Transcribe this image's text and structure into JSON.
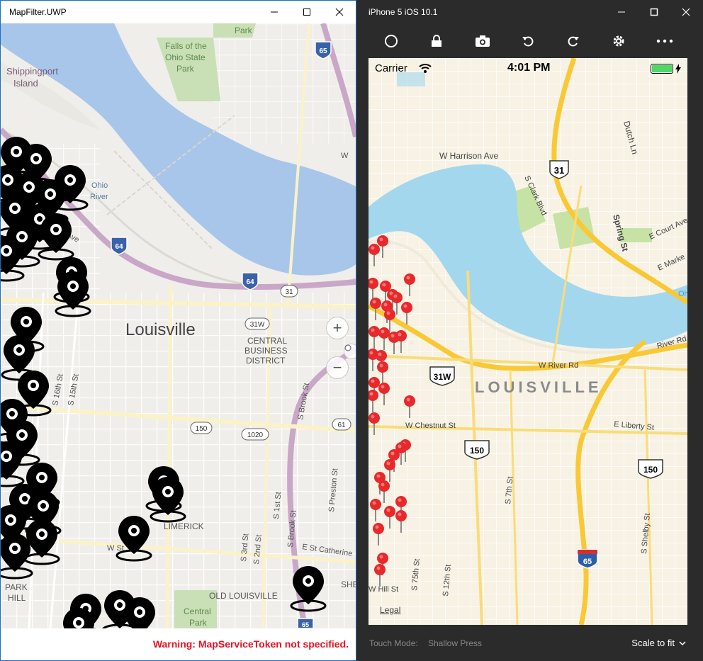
{
  "uwp": {
    "title": "MapFilter.UWP",
    "warning": "Warning: MapServiceToken not specified.",
    "zoom_in_label": "+",
    "zoom_out_label": "−",
    "labels": {
      "city": "Louisville",
      "shippingport": "Shippingport",
      "island": "Island",
      "falls1": "Falls of the",
      "falls2": "Ohio State",
      "falls3": "Park",
      "park_top": "Park",
      "ohio": "Ohio",
      "river": "River",
      "cbd1": "CENTRAL",
      "cbd2": "BUSINESS",
      "cbd3": "DISTRICT",
      "limerick": "LIMERICK",
      "old_louisville": "OLD LOUISVILLE",
      "central1": "Central",
      "central2": "Park",
      "park_hill1": "PARK",
      "park_hill2": "HILL",
      "she": "SHE",
      "s16": "S 16th St",
      "s15": "S 15th St",
      "s3rd": "S 3rd St",
      "s2nd": "S 2nd St",
      "s1st": "S 1st St",
      "sbrook": "S Brook St",
      "sbrook2": "S Brook St",
      "spreston": "S Preston St",
      "ecameron": "E St Catherine",
      "wst": "W St",
      "ave": "Ave",
      "w_edge": "W",
      "shield_65": "65",
      "shield_64a": "64",
      "shield_64b": "64",
      "shield_31": "31",
      "shield_31w": "31W",
      "shield_150": "150",
      "shield_1020": "1020",
      "shield_61": "61",
      "shield_65b": "65"
    }
  },
  "simulator": {
    "title": "iPhone 5 iOS 10.1",
    "toolbar_icons": [
      "home-icon",
      "lock-icon",
      "camera-icon",
      "rotate-left-icon",
      "rotate-right-icon",
      "settings-icon",
      "more-icon"
    ],
    "touch_mode_label": "Touch Mode:",
    "touch_mode_value": "Shallow Press",
    "scale_label": "Scale to fit",
    "status": {
      "carrier": "Carrier",
      "time": "4:01 PM"
    },
    "legal": "Legal",
    "labels": {
      "city": "LOUISVILLE",
      "harrison": "W Harrison Ave",
      "dutch": "Dutch Ln",
      "clark": "S Clark Blvd",
      "spring": "Spring St",
      "court": "E Court Ave",
      "market": "E Marke",
      "river_rd": "W River Rd",
      "river_rd2": "River Rd",
      "chestnut": "W Chestnut St",
      "liberty": "E Liberty St",
      "s7th": "S 7th St",
      "s75th": "S 75th St",
      "s12th": "S 12th St",
      "shelby": "S Shelby St",
      "whill": "W Hill St",
      "ohi": "Ohi",
      "shield_31": "31",
      "shield_31w": "31W",
      "shield_150a": "150",
      "shield_150b": "150",
      "shield_65": "65"
    }
  },
  "colors": {
    "uwp_water": "#a7c6ea",
    "ios_water": "#a3d7ee",
    "highway_purple": "#c9a7c7",
    "ios_highway": "#f9c935",
    "park_green": "#c9dfb6",
    "warning_red": "#e81123",
    "pin_red": "#e8282b"
  }
}
